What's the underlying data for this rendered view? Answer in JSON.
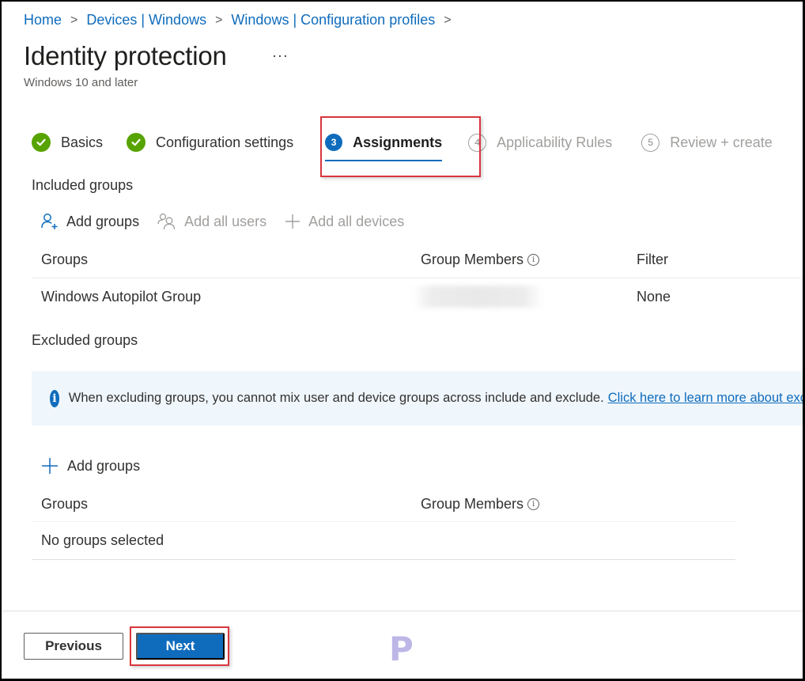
{
  "breadcrumb": {
    "items": [
      "Home",
      "Devices | Windows",
      "Windows | Configuration profiles"
    ],
    "separator": ">"
  },
  "header": {
    "title": "Identity protection",
    "more_label": "···",
    "subtitle": "Windows 10 and later"
  },
  "wizard": {
    "steps": [
      {
        "number": "1",
        "label": "Basics",
        "state": "completed"
      },
      {
        "number": "2",
        "label": "Configuration settings",
        "state": "completed"
      },
      {
        "number": "3",
        "label": "Assignments",
        "state": "current"
      },
      {
        "number": "4",
        "label": "Applicability Rules",
        "state": "upcoming"
      },
      {
        "number": "5",
        "label": "Review + create",
        "state": "upcoming"
      }
    ]
  },
  "included": {
    "heading": "Included groups",
    "toolbar": {
      "add_groups": "Add groups",
      "add_all_users": "Add all users",
      "add_all_devices": "Add all devices"
    },
    "columns": {
      "groups": "Groups",
      "members": "Group Members",
      "filter": "Filter"
    },
    "rows": [
      {
        "group": "Windows Autopilot Group",
        "members": "",
        "filter": "None"
      }
    ]
  },
  "excluded": {
    "heading": "Excluded groups",
    "info_text": "When excluding groups, you cannot mix user and device groups across include and exclude.",
    "info_link": "Click here to learn more about exc",
    "add_groups": "Add groups",
    "columns": {
      "groups": "Groups",
      "members": "Group Members"
    },
    "empty_text": "No groups selected"
  },
  "footer": {
    "previous": "Previous",
    "next": "Next"
  },
  "watermark": "P",
  "colors": {
    "accent": "#0f6cbd",
    "success": "#57a300",
    "highlight": "#d9363e",
    "info_bg": "#eff6fc"
  }
}
